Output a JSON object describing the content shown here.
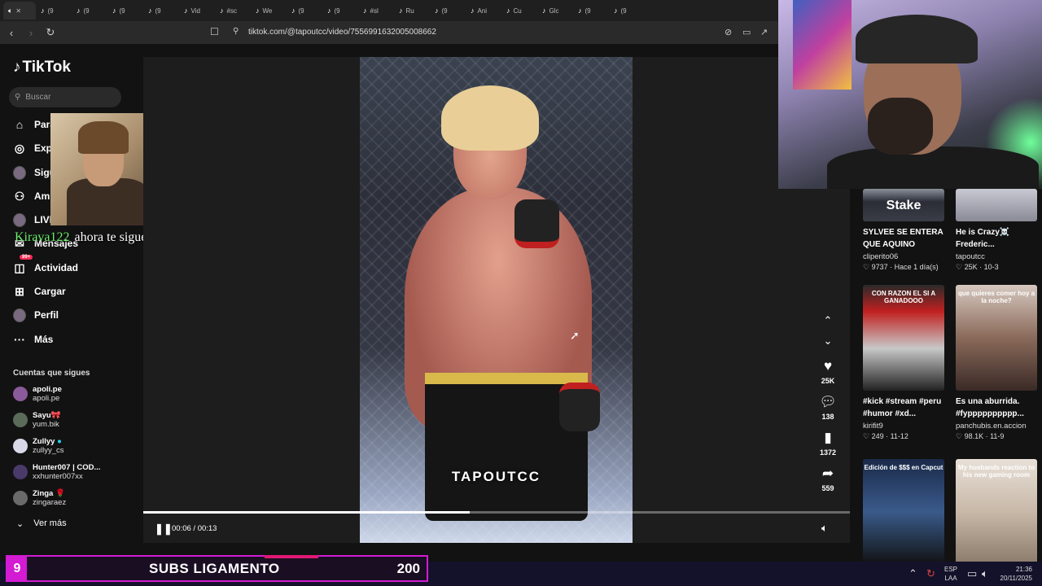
{
  "browser": {
    "tabs": [
      "(9",
      "(9",
      "(9",
      "(9",
      "Vid",
      "#sc",
      "We",
      "(9",
      "(9",
      "#sl",
      "Ru",
      "(9",
      "Ani",
      "Cu",
      "Glc",
      "(9",
      "(9"
    ],
    "url": "tiktok.com/@tapoutcc/video/7556991632005008662"
  },
  "sidebar": {
    "logo": "TikTok",
    "search_placeholder": "Buscar",
    "nav": [
      {
        "label": "Para",
        "icon": "home-icon"
      },
      {
        "label": "Exp",
        "icon": "compass-icon"
      },
      {
        "label": "Sigu",
        "icon": "avatar-icon"
      },
      {
        "label": "Ami",
        "icon": "friends-icon"
      },
      {
        "label": "LIVE",
        "icon": "live-icon"
      },
      {
        "label": "Mensajes",
        "icon": "message-icon"
      },
      {
        "label": "Actividad",
        "icon": "activity-icon",
        "badge": "99+"
      },
      {
        "label": "Cargar",
        "icon": "upload-icon"
      },
      {
        "label": "Perfil",
        "icon": "profile-icon"
      },
      {
        "label": "Más",
        "icon": "more-icon"
      }
    ],
    "following_title": "Cuentas que sigues",
    "accounts": [
      {
        "name": "apoli.pe",
        "user": "apoli.pe"
      },
      {
        "name": "Sayu🎀",
        "user": "yum.bik"
      },
      {
        "name": "Zullyy",
        "user": "zullyy_cs",
        "verified": true
      },
      {
        "name": "Hunter007 | COD...",
        "user": "xxhunter007xx"
      },
      {
        "name": "Zinga 🌹",
        "user": "zingaraez"
      }
    ],
    "see_more": "Ver más"
  },
  "alert": {
    "who": "Kirava122",
    "text": "ahora te sigue! SAPE"
  },
  "player": {
    "watermark": "TAPOUTCC",
    "time": "00:06 / 00:13",
    "progress": 0.4615,
    "likes": "25K",
    "comments": "138",
    "saves": "1372",
    "shares": "559"
  },
  "recommended": [
    {
      "caption": "SYLVEE SE ENTERA QUE AQUINO ENTR...",
      "user": "cliperito06",
      "meta": "♡ 9737 · Hace 1 día(s)",
      "thumb_label": "Stake"
    },
    {
      "caption": "He is Crazy☠️ Frederic...",
      "user": "tapoutcc",
      "meta": "♡ 25K · 10-3",
      "thumb_label": ""
    },
    {
      "caption": "#kick #stream #peru #humor #xd...",
      "user": "kirifit9",
      "meta": "♡ 249 · 11-12",
      "thumb_label": "CON RAZON EL SI A GANADOOO"
    },
    {
      "caption": "Es una aburrida. #fypppppppppp...",
      "user": "panchubis.en.accion",
      "meta": "♡ 98.1K · 11-9",
      "thumb_label": "que quieres comer hoy a la noche?"
    },
    {
      "caption": "",
      "user": "",
      "meta": "",
      "thumb_label": "Edición de $$$ en Capcut"
    },
    {
      "caption": "",
      "user": "",
      "meta": "",
      "thumb_label": "My husbands reaction to his new gaming room"
    }
  ],
  "banner": {
    "num": "9",
    "title": "SUBS LIGAMENTO",
    "count": "200"
  },
  "taskbar": {
    "lang1": "ESP",
    "lang2": "LAA",
    "time": "21:36",
    "date": "20/11/2025"
  }
}
